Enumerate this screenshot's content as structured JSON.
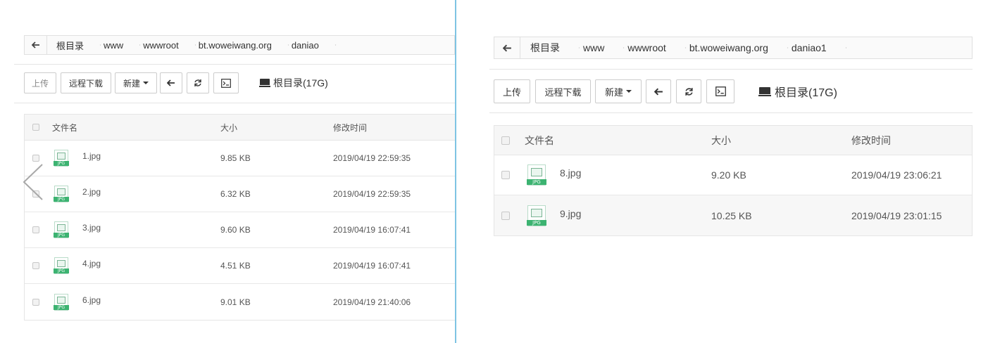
{
  "left": {
    "breadcrumb": [
      "根目录",
      "www",
      "wwwroot",
      "bt.woweiwang.org",
      "daniao"
    ],
    "toolbar": {
      "upload_label": "上传",
      "remote_download_label": "远程下载",
      "new_label": "新建",
      "disk_label": "根目录(17G)"
    },
    "table": {
      "headers": {
        "name": "文件名",
        "size": "大小",
        "mtime": "修改时间"
      },
      "rows": [
        {
          "name": "1.jpg",
          "size": "9.85 KB",
          "mtime": "2019/04/19 22:59:35"
        },
        {
          "name": "2.jpg",
          "size": "6.32 KB",
          "mtime": "2019/04/19 22:59:35"
        },
        {
          "name": "3.jpg",
          "size": "9.60 KB",
          "mtime": "2019/04/19 16:07:41"
        },
        {
          "name": "4.jpg",
          "size": "4.51 KB",
          "mtime": "2019/04/19 16:07:41"
        },
        {
          "name": "6.jpg",
          "size": "9.01 KB",
          "mtime": "2019/04/19 21:40:06"
        }
      ]
    }
  },
  "right": {
    "breadcrumb": [
      "根目录",
      "www",
      "wwwroot",
      "bt.woweiwang.org",
      "daniao1"
    ],
    "toolbar": {
      "upload_label": "上传",
      "remote_download_label": "远程下载",
      "new_label": "新建",
      "disk_label": "根目录(17G)"
    },
    "table": {
      "headers": {
        "name": "文件名",
        "size": "大小",
        "mtime": "修改时间"
      },
      "rows": [
        {
          "name": "8.jpg",
          "size": "9.20 KB",
          "mtime": "2019/04/19 23:06:21"
        },
        {
          "name": "9.jpg",
          "size": "10.25 KB",
          "mtime": "2019/04/19 23:01:15"
        }
      ]
    }
  },
  "file_icon_tag": "JPG",
  "icons": {
    "back": "arrow-left-icon",
    "refresh": "refresh-icon",
    "terminal": "terminal-icon",
    "disk": "disk-icon",
    "file": "jpg-file-icon",
    "prev": "chevron-left-icon"
  },
  "colors": {
    "divider": "#7ec4e3",
    "file_tag": "#3cb371"
  }
}
